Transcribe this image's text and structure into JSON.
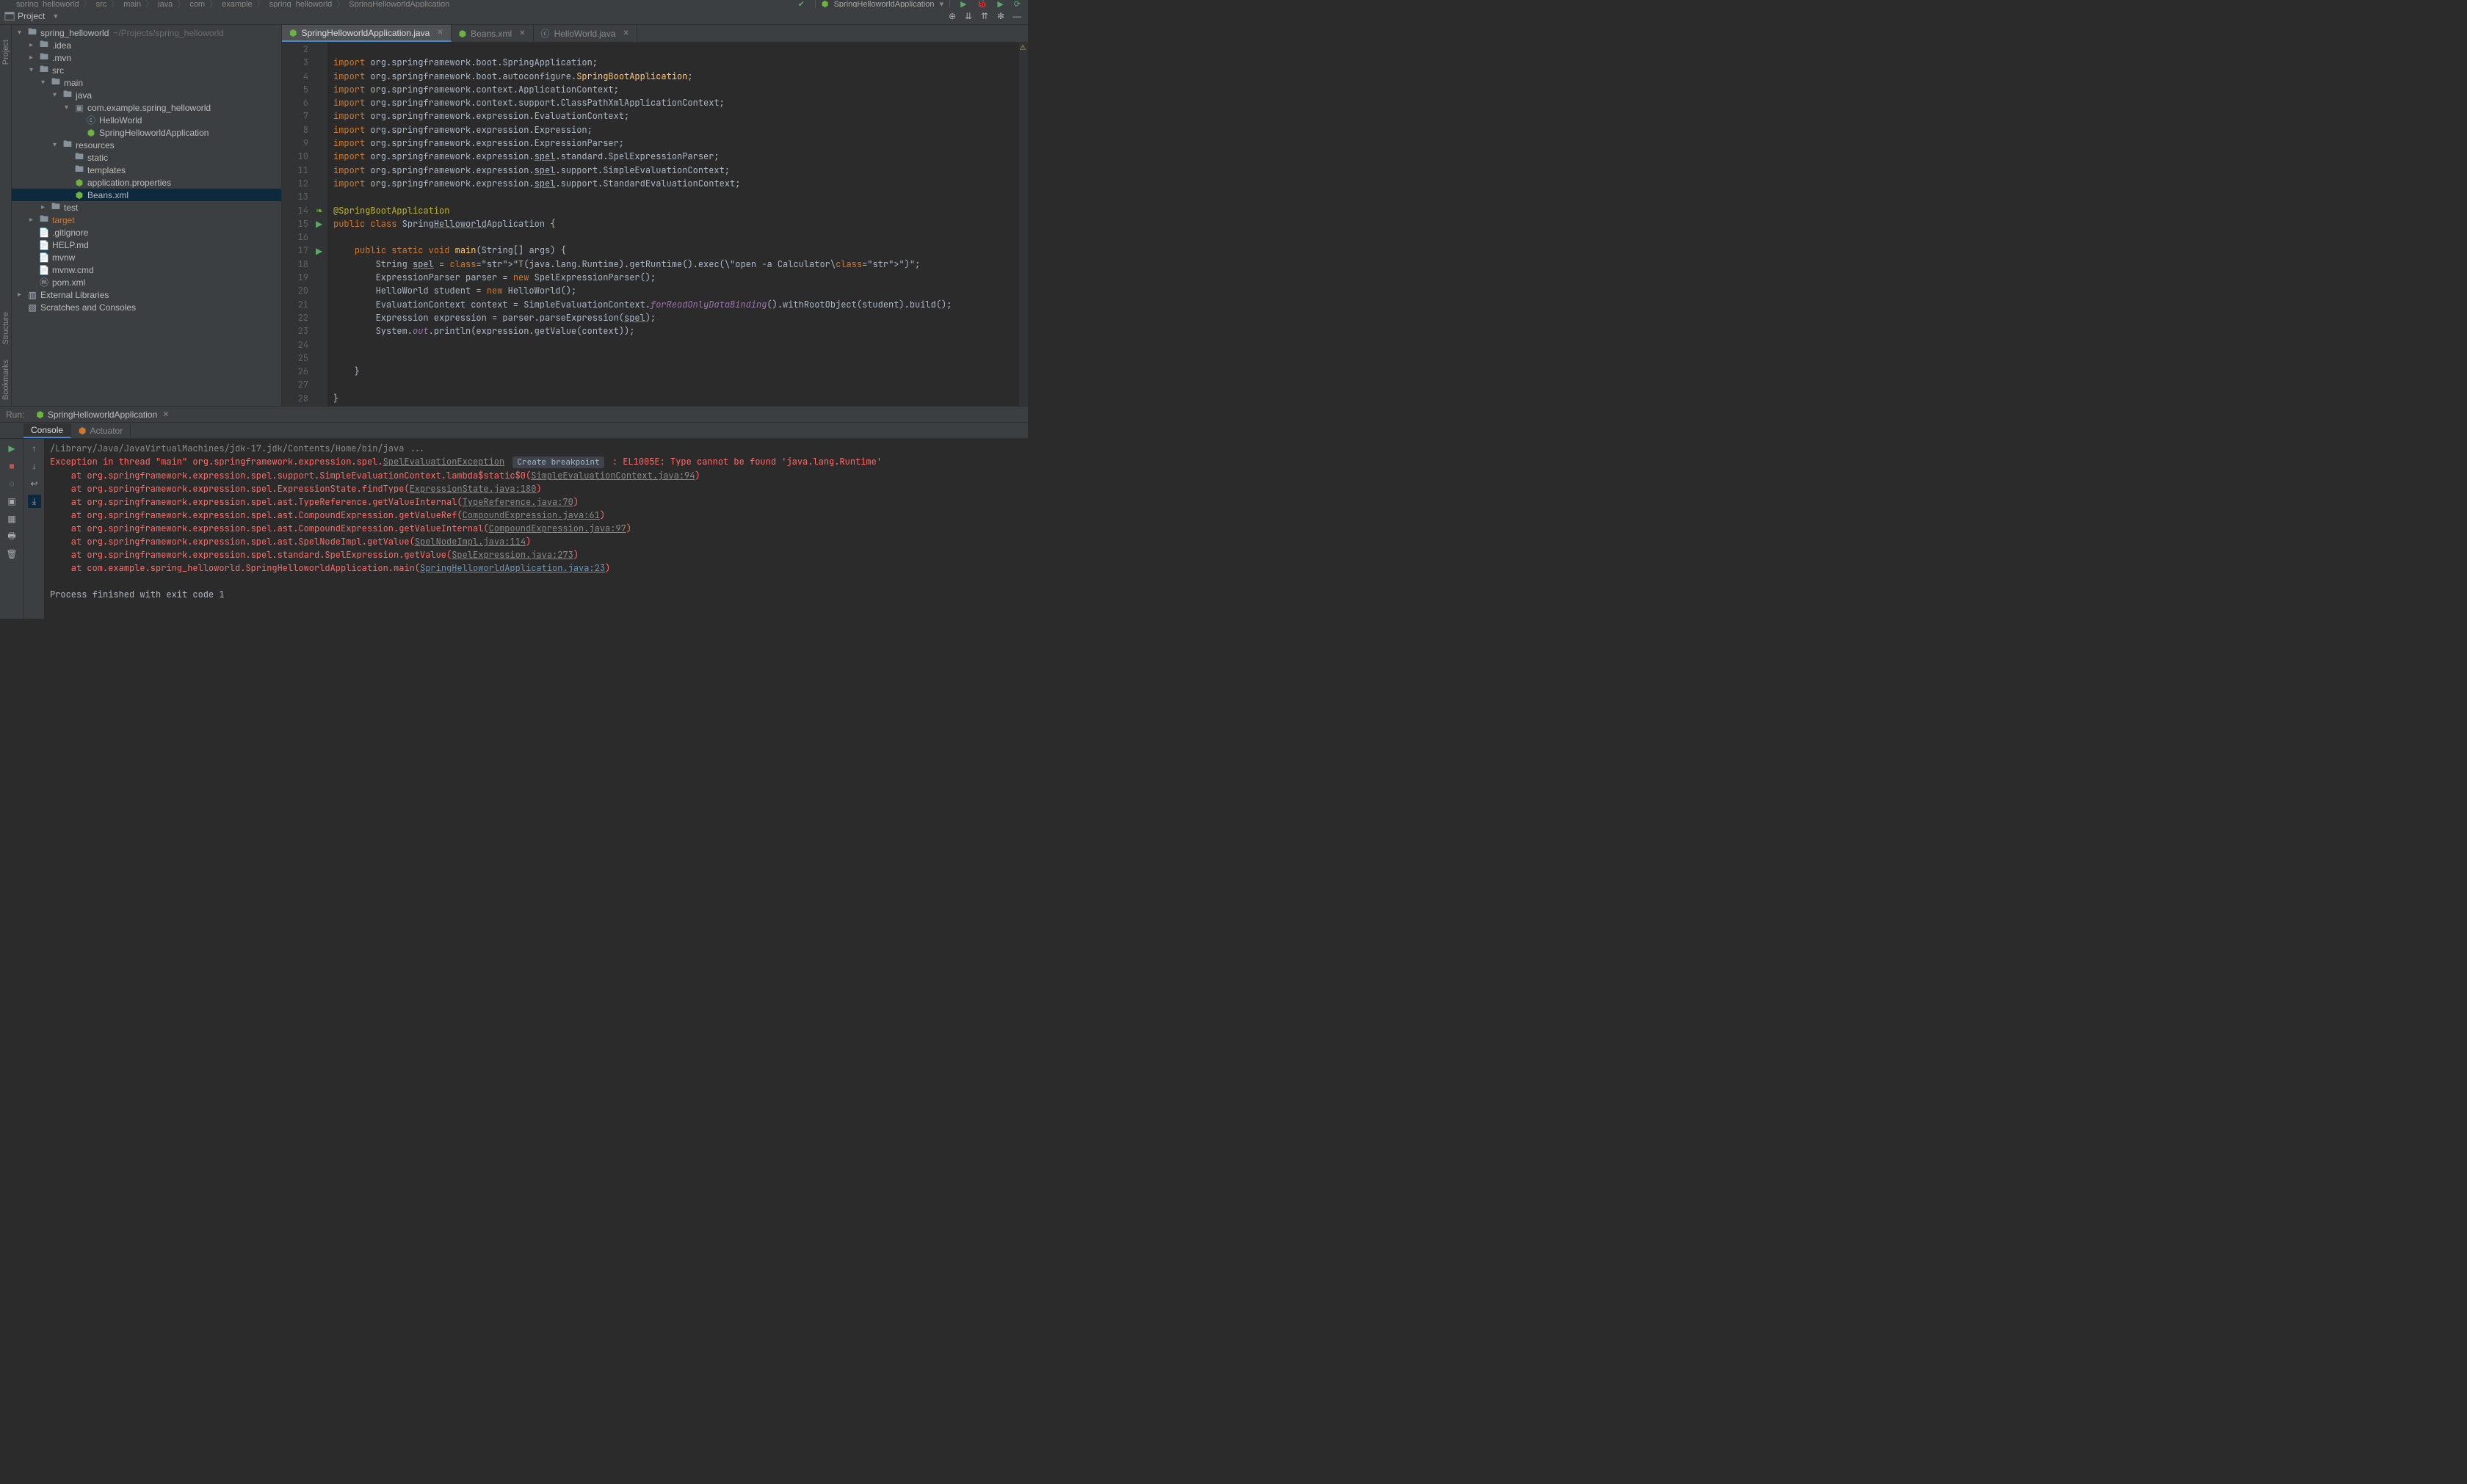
{
  "breadcrumb": {
    "segments": [
      "spring_helloworld",
      "src",
      "main",
      "java",
      "com",
      "example",
      "spring_helloworld",
      "SpringHelloworldApplication"
    ],
    "run_config": "SpringHelloworldApplication"
  },
  "project_toolbar": {
    "label": "Project"
  },
  "left_rail": {
    "project": "Project",
    "structure": "Structure",
    "bookmarks": "Bookmarks"
  },
  "tree": {
    "root": {
      "name": "spring_helloworld",
      "path": "~/Projects/spring_helloworld"
    },
    "idea": ".idea",
    "mvn": ".mvn",
    "src": "src",
    "main": "main",
    "java": "java",
    "pkg": "com.example.spring_helloworld",
    "hello": "HelloWorld",
    "app": "SpringHelloworldApplication",
    "resources": "resources",
    "static": "static",
    "templates": "templates",
    "appprops": "application.properties",
    "beans": "Beans.xml",
    "test": "test",
    "target": "target",
    "gitignore": ".gitignore",
    "help": "HELP.md",
    "mvnw": "mvnw",
    "mvnwcmd": "mvnw.cmd",
    "pom": "pom.xml",
    "ext": "External Libraries",
    "scratch": "Scratches and Consoles"
  },
  "tabs": [
    {
      "label": "SpringHelloworldApplication.java",
      "active": true,
      "icon": "spring"
    },
    {
      "label": "Beans.xml",
      "active": false,
      "icon": "spring"
    },
    {
      "label": "HelloWorld.java",
      "active": false,
      "icon": "java"
    }
  ],
  "editor": {
    "first_line": 2,
    "lines": [
      "",
      "import org.springframework.boot.SpringApplication;",
      "import org.springframework.boot.autoconfigure.SpringBootApplication;",
      "import org.springframework.context.ApplicationContext;",
      "import org.springframework.context.support.ClassPathXmlApplicationContext;",
      "import org.springframework.expression.EvaluationContext;",
      "import org.springframework.expression.Expression;",
      "import org.springframework.expression.ExpressionParser;",
      "import org.springframework.expression.spel.standard.SpelExpressionParser;",
      "import org.springframework.expression.spel.support.SimpleEvaluationContext;",
      "import org.springframework.expression.spel.support.StandardEvaluationContext;",
      "",
      "@SpringBootApplication",
      "public class SpringHelloworldApplication {",
      "",
      "    public static void main(String[] args) {",
      "        String spel = \"T(java.lang.Runtime).getRuntime().exec(\\\"open -a Calculator\\\")\";",
      "        ExpressionParser parser = new SpelExpressionParser();",
      "        HelloWorld student = new HelloWorld();",
      "        EvaluationContext context = SimpleEvaluationContext.forReadOnlyDataBinding().withRootObject(student).build();",
      "        Expression expression = parser.parseExpression(spel);",
      "        System.out.println(expression.getValue(context));",
      "",
      "",
      "    }",
      "",
      "}",
      ""
    ],
    "gutter_marks": {
      "14": "leaf",
      "15": "run",
      "17": "run"
    }
  },
  "run": {
    "label": "Run:",
    "config": "SpringHelloworldApplication",
    "tabs": {
      "console": "Console",
      "actuator": "Actuator"
    },
    "cmd": "/Library/Java/JavaVirtualMachines/jdk-17.jdk/Contents/Home/bin/java ...",
    "exc_head_pre": "Exception in thread \"main\" org.springframework.expression.spel.",
    "exc_head_link": "SpelEvaluationException",
    "exc_head_bp": "Create breakpoint",
    "exc_head_post": " : EL1005E: Type cannot be found 'java.lang.Runtime'",
    "frames": [
      {
        "pre": "    at org.springframework.expression.spel.support.SimpleEvaluationContext.lambda$static$0(",
        "link": "SimpleEvaluationContext.java:94",
        "post": ")"
      },
      {
        "pre": "    at org.springframework.expression.spel.ExpressionState.findType(",
        "link": "ExpressionState.java:180",
        "post": ")"
      },
      {
        "pre": "    at org.springframework.expression.spel.ast.TypeReference.getValueInternal(",
        "link": "TypeReference.java:70",
        "post": ")"
      },
      {
        "pre": "    at org.springframework.expression.spel.ast.CompoundExpression.getValueRef(",
        "link": "CompoundExpression.java:61",
        "post": ")"
      },
      {
        "pre": "    at org.springframework.expression.spel.ast.CompoundExpression.getValueInternal(",
        "link": "CompoundExpression.java:97",
        "post": ")"
      },
      {
        "pre": "    at org.springframework.expression.spel.ast.SpelNodeImpl.getValue(",
        "link": "SpelNodeImpl.java:114",
        "post": ")"
      },
      {
        "pre": "    at org.springframework.expression.spel.standard.SpelExpression.getValue(",
        "link": "SpelExpression.java:273",
        "post": ")"
      },
      {
        "pre": "    at com.example.spring_helloworld.SpringHelloworldApplication.main(",
        "link": "SpringHelloworldApplication.java:23",
        "post": ")",
        "own": true
      }
    ],
    "exit": "Process finished with exit code 1"
  }
}
